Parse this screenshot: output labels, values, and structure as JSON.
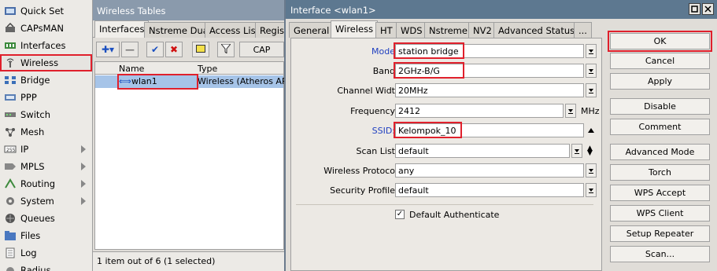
{
  "sidebar": {
    "items": [
      {
        "label": "Quick Set",
        "icon": "quick-set-icon"
      },
      {
        "label": "CAPsMAN",
        "icon": "capsman-icon"
      },
      {
        "label": "Interfaces",
        "icon": "interfaces-icon"
      },
      {
        "label": "Wireless",
        "icon": "wireless-icon"
      },
      {
        "label": "Bridge",
        "icon": "bridge-icon"
      },
      {
        "label": "PPP",
        "icon": "ppp-icon"
      },
      {
        "label": "Switch",
        "icon": "switch-icon"
      },
      {
        "label": "Mesh",
        "icon": "mesh-icon"
      },
      {
        "label": "IP",
        "icon": "ip-icon"
      },
      {
        "label": "MPLS",
        "icon": "mpls-icon"
      },
      {
        "label": "Routing",
        "icon": "routing-icon"
      },
      {
        "label": "System",
        "icon": "system-icon"
      },
      {
        "label": "Queues",
        "icon": "queues-icon"
      },
      {
        "label": "Files",
        "icon": "files-icon"
      },
      {
        "label": "Log",
        "icon": "log-icon"
      },
      {
        "label": "Radius",
        "icon": "radius-icon"
      }
    ]
  },
  "wireless_tables": {
    "title": "Wireless Tables",
    "tabs": [
      "Interfaces",
      "Nstreme Dual",
      "Access List",
      "Regist"
    ],
    "cap_label": "CAP",
    "columns": [
      "Name",
      "Type"
    ],
    "row": {
      "name": "wlan1",
      "type": "Wireless (Atheros AR"
    },
    "status": "1 item out of 6 (1 selected)"
  },
  "dialog": {
    "title": "Interface <wlan1>",
    "tabs": [
      "General",
      "Wireless",
      "HT",
      "WDS",
      "Nstreme",
      "NV2",
      "Advanced Status",
      "..."
    ],
    "fields": {
      "mode": {
        "label": "Mode",
        "value": "station bridge"
      },
      "band": {
        "label": "Band",
        "value": "2GHz-B/G"
      },
      "channel_width": {
        "label": "Channel Widt",
        "value": "20MHz"
      },
      "frequency": {
        "label": "Frequency",
        "value": "2412",
        "unit": "MHz"
      },
      "ssid": {
        "label": "SSID:",
        "value": "Kelompok_10"
      },
      "scan_list": {
        "label": "Scan List",
        "value": "default"
      },
      "wireless_protocol": {
        "label": "Wireless Protoco",
        "value": "any"
      },
      "security_profile": {
        "label": "Security Profile",
        "value": "default"
      }
    },
    "default_authenticate": {
      "label": "Default Authenticate",
      "checked": true,
      "mark": "✓"
    },
    "buttons": [
      "OK",
      "Cancel",
      "Apply",
      "Disable",
      "Comment",
      "Advanced Mode",
      "Torch",
      "WPS Accept",
      "WPS Client",
      "Setup Repeater",
      "Scan..."
    ]
  },
  "colors": {
    "highlight": "#e0202c",
    "selected_row": "#a6c4e8",
    "dialog_title": "#5d7890"
  }
}
